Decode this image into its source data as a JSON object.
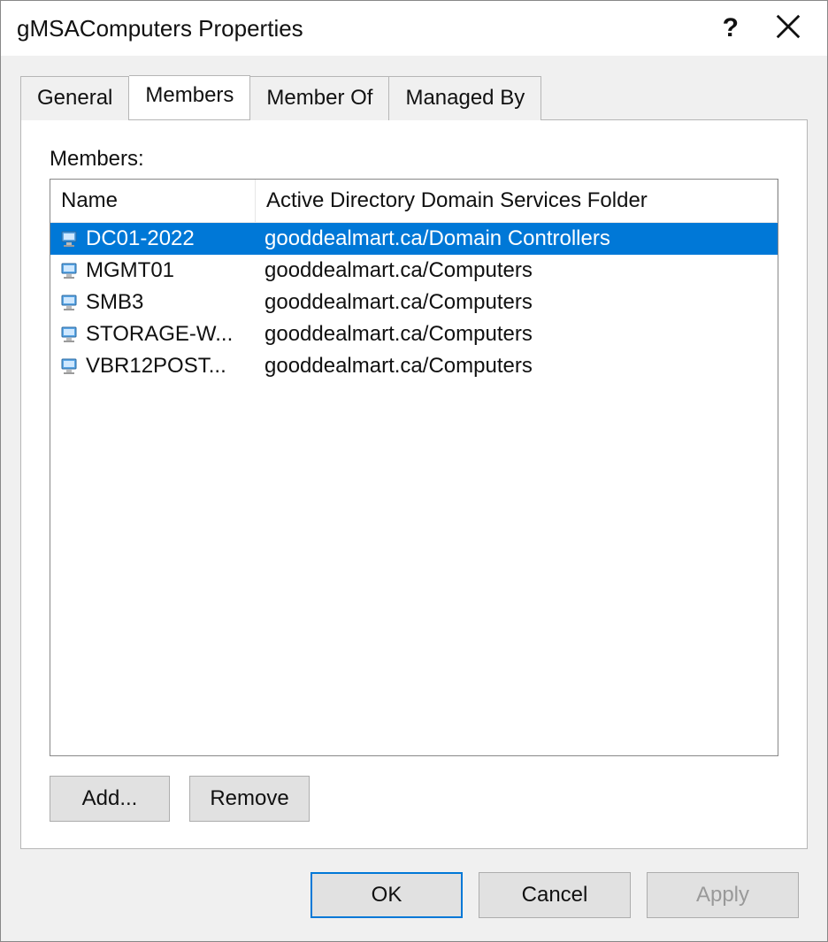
{
  "window": {
    "title": "gMSAComputers Properties"
  },
  "tabs": {
    "general": "General",
    "members": "Members",
    "memberOf": "Member Of",
    "managedBy": "Managed By",
    "active": "members"
  },
  "panel": {
    "membersLabel": "Members:",
    "columns": {
      "name": "Name",
      "folder": "Active Directory Domain Services Folder"
    },
    "items": [
      {
        "name": "DC01-2022",
        "folder": "gooddealmart.ca/Domain Controllers",
        "selected": true
      },
      {
        "name": "MGMT01",
        "folder": "gooddealmart.ca/Computers",
        "selected": false
      },
      {
        "name": "SMB3",
        "folder": "gooddealmart.ca/Computers",
        "selected": false
      },
      {
        "name": "STORAGE-W...",
        "folder": "gooddealmart.ca/Computers",
        "selected": false
      },
      {
        "name": "VBR12POST...",
        "folder": "gooddealmart.ca/Computers",
        "selected": false
      }
    ],
    "buttons": {
      "add": "Add...",
      "remove": "Remove"
    }
  },
  "footer": {
    "ok": "OK",
    "cancel": "Cancel",
    "apply": "Apply"
  }
}
